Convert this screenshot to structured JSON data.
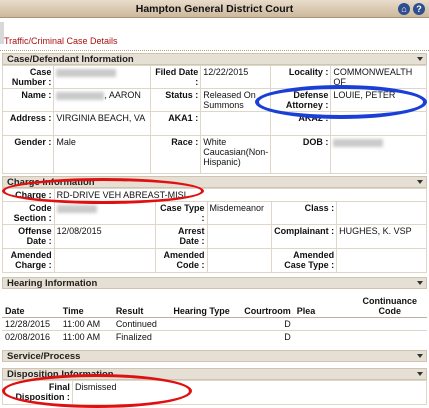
{
  "window": {
    "title": "Hampton General District Court"
  },
  "subtitle": "Traffic/Criminal Case Details",
  "sections": {
    "case_defendant": "Case/Defendant Information",
    "charge": "Charge Information",
    "hearing": "Hearing Information",
    "service": "Service/Process",
    "disposition": "Disposition Information"
  },
  "case": {
    "case_number_label": "Case Number :",
    "filed_label": "Filed Date :",
    "filed_value": "12/22/2015",
    "locality_label": "Locality :",
    "locality_value": "COMMONWEALTH OF",
    "name_label": "Name :",
    "name_value": ", AARON",
    "status_label": "Status :",
    "status_value": "Released On Summons",
    "defense_label": "Defense Attorney :",
    "defense_value": "LOUIE, PETER",
    "address_label": "Address :",
    "address_value": "VIRGINIA BEACH, VA",
    "aka1_label": "AKA1 :",
    "aka2_label": "AKA2 :",
    "gender_label": "Gender :",
    "gender_value": "Male",
    "race_label": "Race :",
    "race_value": "White Caucasian(Non-Hispanic)",
    "dob_label": "DOB :"
  },
  "charge": {
    "charge_label": "Charge :",
    "charge_value": "RD-DRIVE VEH ABREAST-MISI",
    "code_section_label": "Code Section :",
    "case_type_label": "Case Type :",
    "case_type_value": "Misdemeanor",
    "class_label": "Class :",
    "offense_date_label": "Offense Date :",
    "offense_date_value": "12/08/2015",
    "arrest_date_label": "Arrest Date :",
    "complainant_label": "Complainant :",
    "complainant_value": "HUGHES, K. VSP",
    "amended_charge_label": "Amended Charge :",
    "amended_code_label": "Amended Code :",
    "amended_case_type_label": "Amended Case Type :"
  },
  "hearing": {
    "columns": [
      "Date",
      "Time",
      "Result",
      "Hearing Type",
      "Courtroom",
      "Plea",
      "Continuance Code"
    ],
    "rows": [
      {
        "date": "12/28/2015",
        "time": "11:00 AM",
        "result": "Continued",
        "hearing_type": "",
        "courtroom": "D",
        "plea": "",
        "continuance": ""
      },
      {
        "date": "02/08/2016",
        "time": "11:00 AM",
        "result": "Finalized",
        "hearing_type": "",
        "courtroom": "D",
        "plea": "",
        "continuance": ""
      }
    ]
  },
  "disposition": {
    "final_label": "Final Disposition :",
    "final_value": "Dismissed"
  },
  "colors": {
    "highlight_red": "#e01010",
    "highlight_blue": "#1a3fd6",
    "header_bg": "#cdb89c"
  }
}
